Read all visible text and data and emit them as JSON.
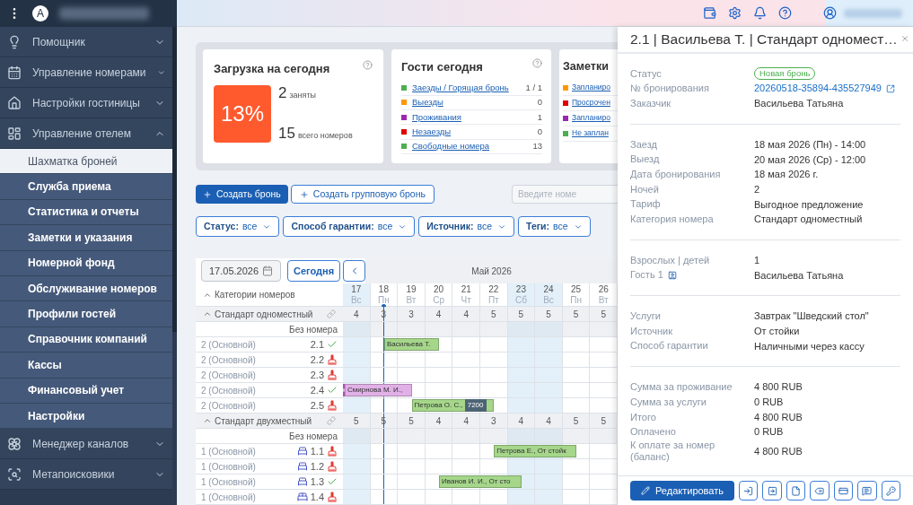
{
  "topbar": {
    "avatar_letter": "A"
  },
  "sidebar": {
    "items": [
      {
        "label": "Помощник",
        "expanded": false
      },
      {
        "label": "Управление номерами",
        "expanded": false
      },
      {
        "label": "Настройки гостиницы",
        "expanded": false
      },
      {
        "label": "Управление отелем",
        "expanded": true,
        "children": [
          {
            "label": "Шахматка броней",
            "selected": true
          },
          {
            "label": "Служба приема",
            "selected": false
          },
          {
            "label": "Статистика и отчеты",
            "selected": false
          },
          {
            "label": "Заметки и указания",
            "selected": false
          },
          {
            "label": "Номерной фонд",
            "selected": false
          },
          {
            "label": "Обслуживание номеров",
            "selected": false
          },
          {
            "label": "Профили гостей",
            "selected": false
          },
          {
            "label": "Справочник компаний",
            "selected": false
          },
          {
            "label": "Кассы",
            "selected": false
          },
          {
            "label": "Финансовый учет",
            "selected": false
          },
          {
            "label": "Настройки",
            "selected": false
          }
        ]
      },
      {
        "label": "Менеджер каналов",
        "expanded": false
      },
      {
        "label": "Метапоисковики",
        "expanded": false
      }
    ]
  },
  "occupancy": {
    "title": "Загрузка на сегодня",
    "percent": "13%",
    "occupied_count": "2",
    "occupied_label": "заняты",
    "total_count": "15",
    "total_label": "всего номеров"
  },
  "guests": {
    "title": "Гости сегодня",
    "items": [
      {
        "label": "Заезды / Горящая бронь",
        "value": "1 / 1",
        "color": "#4caf50"
      },
      {
        "label": "Выезды",
        "value": "0",
        "color": "#ff9800"
      },
      {
        "label": "Проживания",
        "value": "1",
        "color": "#9c27b0"
      },
      {
        "label": "Незаезды",
        "value": "0",
        "color": "#e00000"
      },
      {
        "label": "Свободные номера",
        "value": "13",
        "color": "#4caf50"
      }
    ]
  },
  "notes": {
    "title": "Заметки",
    "items": [
      {
        "label": "Запланиро",
        "color": "#ff9800"
      },
      {
        "label": "Просрочен",
        "color": "#e00000"
      },
      {
        "label": "Запланиро",
        "color": "#9c27b0"
      },
      {
        "label": "Не заплан",
        "color": "#4caf50"
      }
    ]
  },
  "actions": {
    "create": "Создать бронь",
    "create_group": "Создать групповую бронь",
    "search_placeholder": "Введите номе"
  },
  "filters": [
    {
      "label": "Статус:",
      "value": "все"
    },
    {
      "label": "Способ гарантии:",
      "value": "все"
    },
    {
      "label": "Источник:",
      "value": "все"
    },
    {
      "label": "Теги:",
      "value": "все"
    }
  ],
  "calendar": {
    "date": "17.05.2026",
    "today_button": "Сегодня",
    "month": "Май 2026",
    "categories_label": "Категории номеров",
    "days": [
      {
        "num": "17",
        "dow": "Вс",
        "highlighted": true,
        "today": false
      },
      {
        "num": "18",
        "dow": "Пн",
        "highlighted": false,
        "today": true
      },
      {
        "num": "19",
        "dow": "Вт",
        "highlighted": false,
        "today": false
      },
      {
        "num": "20",
        "dow": "Ср",
        "highlighted": false,
        "today": false
      },
      {
        "num": "21",
        "dow": "Чт",
        "highlighted": false,
        "today": false
      },
      {
        "num": "22",
        "dow": "Пт",
        "highlighted": false,
        "today": false
      },
      {
        "num": "23",
        "dow": "Сб",
        "highlighted": true,
        "today": false
      },
      {
        "num": "24",
        "dow": "Вс",
        "highlighted": true,
        "today": false
      },
      {
        "num": "25",
        "dow": "Пн",
        "highlighted": false,
        "today": false
      },
      {
        "num": "26",
        "dow": "Вт",
        "highlighted": false,
        "today": false
      }
    ],
    "categories": [
      {
        "name": "Стандарт одноместный",
        "counts": [
          "4",
          "3",
          "3",
          "4",
          "4",
          "5",
          "5",
          "5",
          "5",
          "5"
        ],
        "rooms": [
          {
            "kind": "unassigned",
            "label": "Без номера"
          },
          {
            "kind": "room",
            "type": "2 (Основной)",
            "number": "2.1",
            "clean": true,
            "days": [
              {
                "kind": "free"
              },
              {
                "kind": "check_in",
                "name": "Васильева Т.",
                "color": "#a5d68a"
              },
              {
                "kind": "stay"
              },
              {
                "kind": "check_out"
              },
              {
                "kind": "free"
              },
              {
                "kind": "free"
              },
              {
                "kind": "free"
              },
              {
                "kind": "free"
              },
              {
                "kind": "free"
              },
              {
                "kind": "free"
              }
            ]
          },
          {
            "kind": "room",
            "type": "2 (Основной)",
            "number": "2.2",
            "clean": false
          },
          {
            "kind": "room",
            "type": "2 (Основной)",
            "number": "2.3",
            "clean": false
          },
          {
            "kind": "room",
            "type": "2 (Основной)",
            "number": "2.4",
            "clean": true,
            "days": [
              {
                "kind": "continued",
                "name": "Смирнова М. И.,",
                "color": "#e0b0e6"
              },
              {
                "kind": "stay"
              },
              {
                "kind": "check_out"
              },
              {
                "kind": "free"
              },
              {
                "kind": "free"
              },
              {
                "kind": "free"
              },
              {
                "kind": "free"
              },
              {
                "kind": "free"
              },
              {
                "kind": "free"
              },
              {
                "kind": "free"
              }
            ]
          },
          {
            "kind": "room",
            "type": "2 (Основной)",
            "number": "2.5",
            "clean": false,
            "days": [
              {
                "kind": "free"
              },
              {
                "kind": "free"
              },
              {
                "kind": "check_in",
                "name": "Петрова О. С.,",
                "badge": "7200",
                "color": "#a5d68a"
              },
              {
                "kind": "stay"
              },
              {
                "kind": "stay"
              },
              {
                "kind": "check_out"
              },
              {
                "kind": "free"
              },
              {
                "kind": "free"
              },
              {
                "kind": "free"
              },
              {
                "kind": "free"
              }
            ]
          }
        ]
      },
      {
        "name": "Стандарт двухместный",
        "counts": [
          "5",
          "5",
          "5",
          "4",
          "4",
          "3",
          "4",
          "4",
          "5",
          "5"
        ],
        "rooms": [
          {
            "kind": "unassigned",
            "label": "Без номера"
          },
          {
            "kind": "single_bed_room",
            "type": "1 (Основной)",
            "number": "1.1",
            "clean": false,
            "days": [
              {
                "kind": "free"
              },
              {
                "kind": "free"
              },
              {
                "kind": "free"
              },
              {
                "kind": "free"
              },
              {
                "kind": "free"
              },
              {
                "kind": "check_in",
                "name": "Петрова Е., От стойк",
                "color": "#a5d68a"
              },
              {
                "kind": "stay"
              },
              {
                "kind": "stay"
              },
              {
                "kind": "check_out"
              },
              {
                "kind": "free"
              }
            ]
          },
          {
            "kind": "single_bed_room",
            "type": "1 (Основной)",
            "number": "1.2",
            "clean": false
          },
          {
            "kind": "single_bed_room",
            "type": "1 (Основной)",
            "number": "1.3",
            "clean": true,
            "days": [
              {
                "kind": "free"
              },
              {
                "kind": "free"
              },
              {
                "kind": "free"
              },
              {
                "kind": "check_in",
                "name": "Иванов И. И., От сто",
                "color": "#a5d68a"
              },
              {
                "kind": "stay"
              },
              {
                "kind": "stay"
              },
              {
                "kind": "check_out"
              },
              {
                "kind": "free"
              },
              {
                "kind": "free"
              },
              {
                "kind": "free"
              }
            ]
          },
          {
            "kind": "double_bed_room",
            "type": "1 (Основной)",
            "number": "1.4",
            "clean": false
          }
        ]
      }
    ]
  },
  "panel": {
    "title": "2.1 | Васильева Т. | Стандарт одномест…",
    "sections": [
      [
        {
          "label": "Статус",
          "value": "Новая бронь",
          "kind": "badge"
        },
        {
          "label": "№ бронирования",
          "value": "20260518-35894-435527949",
          "kind": "link"
        },
        {
          "label": "Заказчик",
          "value": "Васильева Татьяна",
          "kind": "text"
        }
      ],
      [
        {
          "label": "Заезд",
          "value": "18 мая 2026 (Пн) - 14:00",
          "kind": "text"
        },
        {
          "label": "Выезд",
          "value": "20 мая 2026 (Ср) - 12:00",
          "kind": "text"
        },
        {
          "label": "Дата бронирования",
          "value": "18 мая 2026 г.",
          "kind": "text"
        },
        {
          "label": "Ночей",
          "value": "2",
          "kind": "text"
        },
        {
          "label": "Тариф",
          "value": "Выгодное предложение",
          "kind": "text"
        },
        {
          "label": "Категория номера",
          "value": "Стандарт одноместный",
          "kind": "text"
        }
      ],
      [
        {
          "label": "Взрослых | детей",
          "value": "1",
          "kind": "text"
        },
        {
          "label": "Гость 1",
          "value": "Васильева Татьяна",
          "kind": "guest"
        }
      ],
      [
        {
          "label": "Услуги",
          "value": "Завтрак \"Шведский стол\"",
          "kind": "text"
        },
        {
          "label": "Источник",
          "value": "От стойки",
          "kind": "text"
        },
        {
          "label": "Способ гарантии",
          "value": "Наличными через кассу",
          "kind": "text"
        }
      ],
      [
        {
          "label": "Сумма за проживание",
          "value": "4 800 RUB",
          "kind": "text"
        },
        {
          "label": "Сумма за услуги",
          "value": "0 RUB",
          "kind": "text"
        },
        {
          "label": "Итого",
          "value": "4 800 RUB",
          "kind": "text"
        },
        {
          "label": "Оплачено",
          "value": "0 RUB",
          "kind": "text"
        },
        {
          "label": "К оплате за номер (баланс)",
          "value": "4 800 RUB",
          "kind": "text"
        }
      ]
    ],
    "edit_button": "Редактировать"
  }
}
